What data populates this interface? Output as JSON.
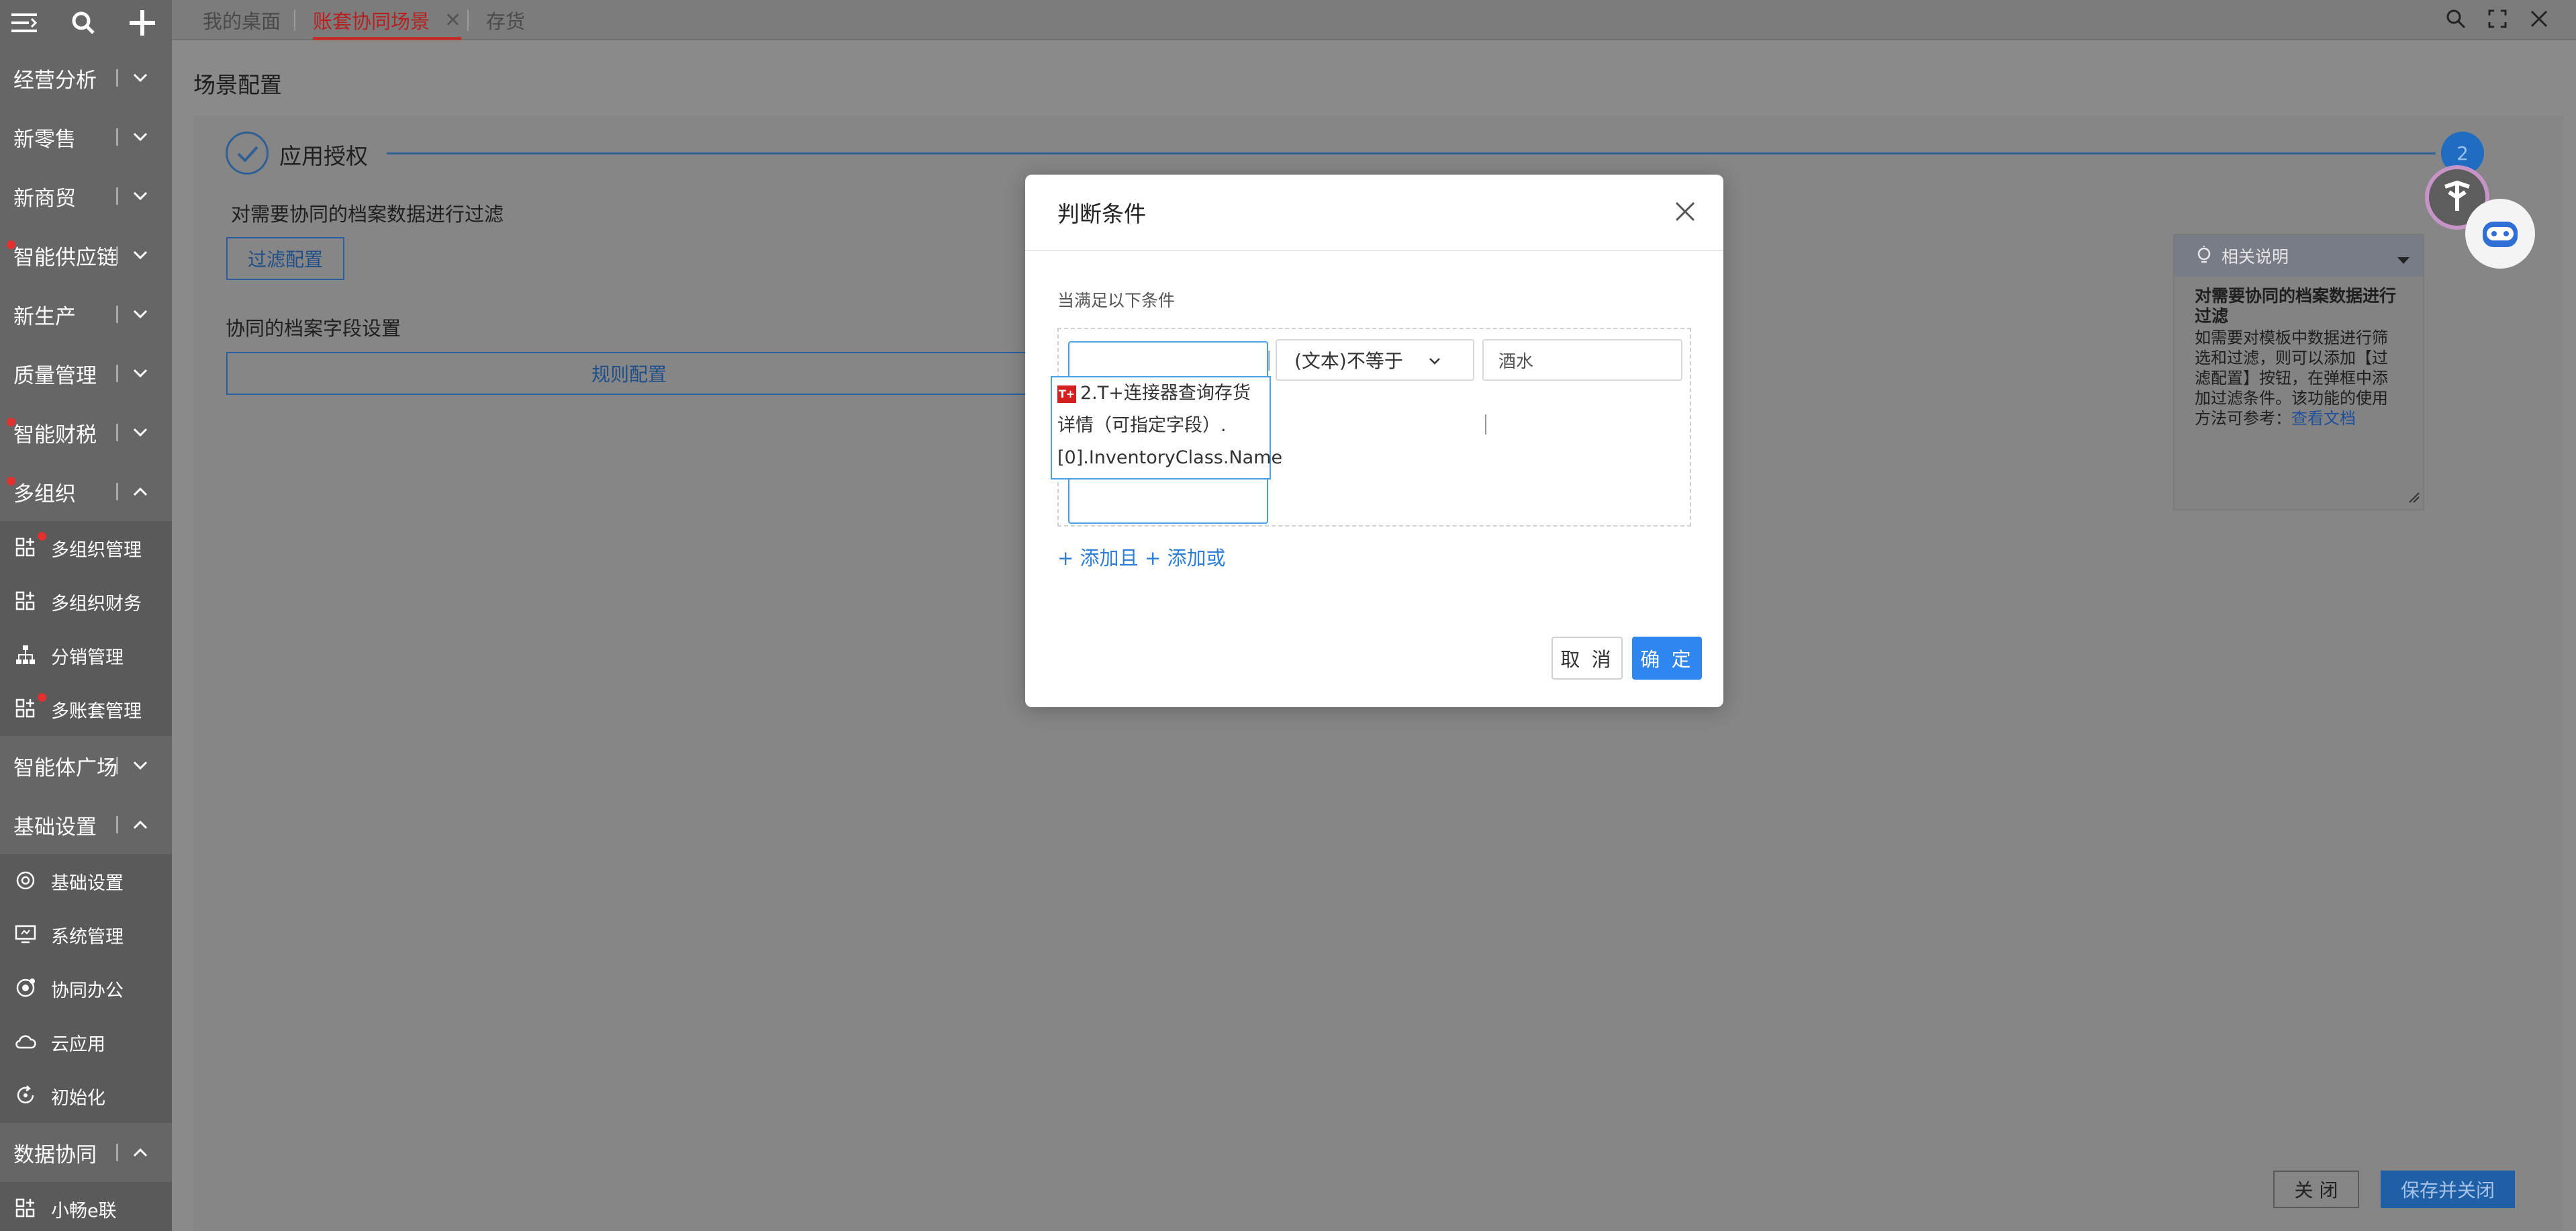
{
  "sidebar": {
    "menu": [
      {
        "label": "经营分析",
        "expanded": false,
        "badge": false
      },
      {
        "label": "新零售",
        "expanded": false,
        "badge": false
      },
      {
        "label": "新商贸",
        "expanded": false,
        "badge": false
      },
      {
        "label": "智能供应链",
        "expanded": false,
        "badge": true
      },
      {
        "label": "新生产",
        "expanded": false,
        "badge": false
      },
      {
        "label": "质量管理",
        "expanded": false,
        "badge": false
      },
      {
        "label": "智能财税",
        "expanded": false,
        "badge": true
      },
      {
        "label": "多组织",
        "expanded": true,
        "badge": true
      }
    ],
    "multi_org_sub": [
      {
        "label": "多组织管理",
        "icon": "grid-plus-icon",
        "badge": true
      },
      {
        "label": "多组织财务",
        "icon": "grid-plus-icon",
        "badge": false
      },
      {
        "label": "分销管理",
        "icon": "org-tree-icon",
        "badge": false
      },
      {
        "label": "多账套管理",
        "icon": "grid-plus-icon",
        "badge": true
      }
    ],
    "menu2": [
      {
        "label": "智能体广场",
        "expanded": false
      },
      {
        "label": "基础设置",
        "expanded": true
      }
    ],
    "basic_sub": [
      {
        "label": "基础设置",
        "icon": "settings-circle-icon"
      },
      {
        "label": "系统管理",
        "icon": "monitor-icon"
      },
      {
        "label": "协同办公",
        "icon": "collab-icon"
      },
      {
        "label": "云应用",
        "icon": "cloud-icon"
      },
      {
        "label": "初始化",
        "icon": "refresh-icon"
      }
    ],
    "menu3": [
      {
        "label": "数据协同",
        "expanded": true
      }
    ],
    "data_sub": [
      {
        "label": "小畅e联",
        "icon": "grid-plus-icon"
      }
    ]
  },
  "tabs": [
    {
      "label": "我的桌面",
      "active": false
    },
    {
      "label": "账套协同场景",
      "active": true,
      "closable": true
    },
    {
      "label": "存货",
      "active": false
    }
  ],
  "page": {
    "title": "场景配置",
    "step1_label": "应用授权",
    "step2_number": "2",
    "filter_desc": "对需要协同的档案数据进行过滤",
    "filter_button": "过滤配置",
    "field_section": "协同的档案字段设置",
    "rule_button": "规则配置"
  },
  "help": {
    "title": "相关说明",
    "heading": "对需要协同的档案数据进行过滤",
    "body": "如需要对模板中数据进行筛选和过滤，则可以添加【过滤配置】按钮，在弹框中添加过滤条件。该功能的使用方法可参考：",
    "link": "查看文档"
  },
  "footer": {
    "close": "关 闭",
    "save_close": "保存并关闭"
  },
  "modal": {
    "title": "判断条件",
    "cond_label": "当满足以下条件",
    "field_line1": "2.T+连接器查询存货",
    "field_line2": "详情（可指定字段）.",
    "field_line3": "[0].InventoryClass.Name",
    "field_logo": "T+",
    "operator": "(文本)不等于",
    "value": "酒水",
    "add_and": "+ 添加且",
    "add_or": "+ 添加或",
    "cancel": "取 消",
    "ok": "确 定"
  },
  "colors": {
    "accent": "#2f86ee",
    "active_tab": "#c0302c",
    "badge": "#e03030"
  }
}
